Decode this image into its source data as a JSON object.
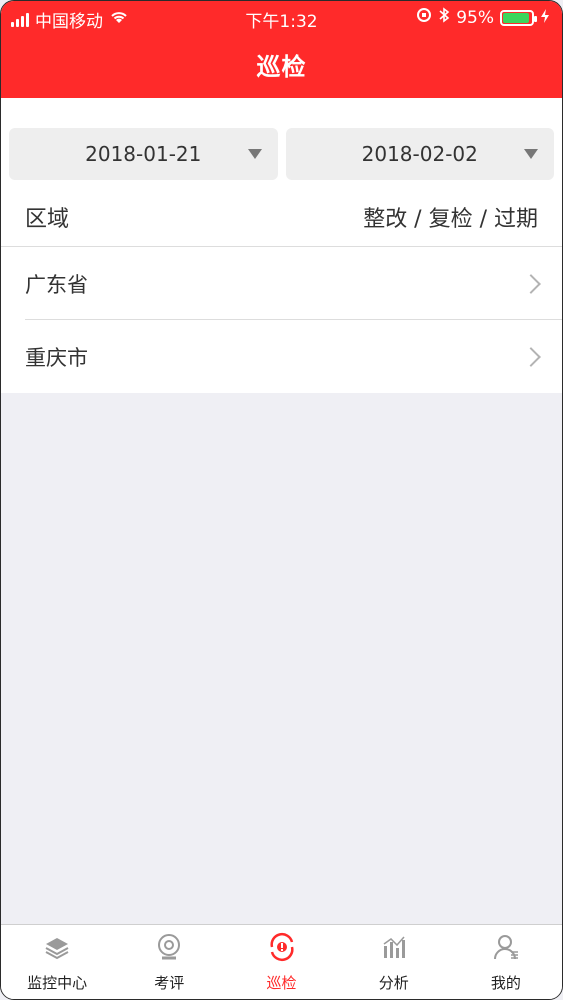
{
  "status_bar": {
    "carrier": "中国移动",
    "time": "下午1:32",
    "battery": "95%"
  },
  "header": {
    "title": "巡检"
  },
  "filters": {
    "start_date": "2018-01-21",
    "end_date": "2018-02-02"
  },
  "table": {
    "left_header": "区域",
    "right_header": "整改 / 复检 / 过期",
    "rows": [
      {
        "label": "广东省"
      },
      {
        "label": "重庆市"
      }
    ]
  },
  "tabbar": {
    "items": [
      {
        "label": "监控中心",
        "icon": "layers-icon"
      },
      {
        "label": "考评",
        "icon": "camera-icon"
      },
      {
        "label": "巡检",
        "icon": "eye-refresh-icon"
      },
      {
        "label": "分析",
        "icon": "chart-icon"
      },
      {
        "label": "我的",
        "icon": "user-icon"
      }
    ],
    "active_index": 2
  },
  "colors": {
    "primary": "#ff2a2a",
    "background": "#efeff4",
    "tab_inactive": "#222222"
  }
}
